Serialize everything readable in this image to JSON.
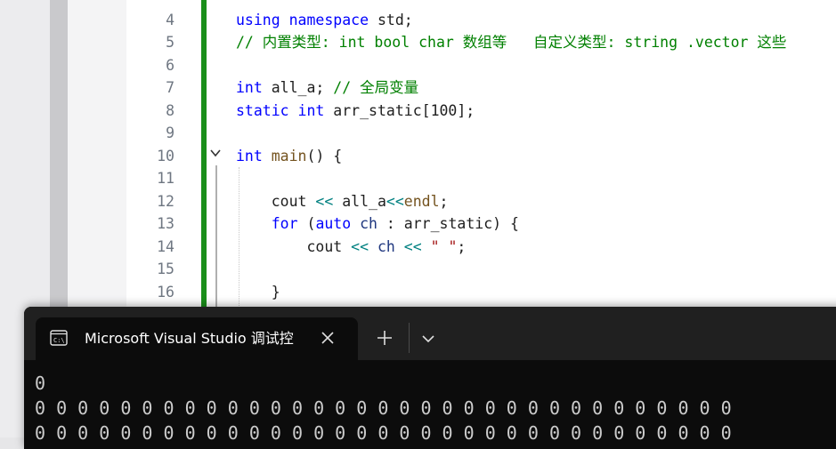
{
  "editor": {
    "lines": [
      {
        "num": "4",
        "segments": [
          {
            "t": "using ",
            "c": "kw"
          },
          {
            "t": "namespace ",
            "c": "kw"
          },
          {
            "t": "std;",
            "c": "pl"
          }
        ]
      },
      {
        "num": "5",
        "segments": [
          {
            "t": "// 内置类型: int bool char 数组等   自定义类型: string .vector 这些",
            "c": "cm"
          }
        ]
      },
      {
        "num": "6",
        "segments": []
      },
      {
        "num": "7",
        "segments": [
          {
            "t": "int ",
            "c": "kw"
          },
          {
            "t": "all_a; ",
            "c": "pl"
          },
          {
            "t": "// 全局变量",
            "c": "cm"
          }
        ]
      },
      {
        "num": "8",
        "segments": [
          {
            "t": "static ",
            "c": "kw"
          },
          {
            "t": "int ",
            "c": "kw"
          },
          {
            "t": "arr_static[100];",
            "c": "pl"
          }
        ]
      },
      {
        "num": "9",
        "segments": []
      },
      {
        "num": "10",
        "segments": [
          {
            "t": "int ",
            "c": "kw"
          },
          {
            "t": "main",
            "c": "fn"
          },
          {
            "t": "() {",
            "c": "pl"
          }
        ]
      },
      {
        "num": "11",
        "segments": []
      },
      {
        "num": "12",
        "segments": [
          {
            "t": "    cout ",
            "c": "pl"
          },
          {
            "t": "<<",
            "c": "op"
          },
          {
            "t": " all_a",
            "c": "pl"
          },
          {
            "t": "<<",
            "c": "op"
          },
          {
            "t": "endl",
            "c": "fn"
          },
          {
            "t": ";",
            "c": "pl"
          }
        ]
      },
      {
        "num": "13",
        "segments": [
          {
            "t": "    ",
            "c": "pl"
          },
          {
            "t": "for ",
            "c": "kw"
          },
          {
            "t": "(",
            "c": "pl"
          },
          {
            "t": "auto ",
            "c": "kw"
          },
          {
            "t": "ch",
            "c": "vr"
          },
          {
            "t": " : arr_static) {",
            "c": "pl"
          }
        ]
      },
      {
        "num": "14",
        "segments": [
          {
            "t": "        cout ",
            "c": "pl"
          },
          {
            "t": "<<",
            "c": "op"
          },
          {
            "t": " ",
            "c": "pl"
          },
          {
            "t": "ch",
            "c": "vr"
          },
          {
            "t": " ",
            "c": "pl"
          },
          {
            "t": "<<",
            "c": "op"
          },
          {
            "t": " ",
            "c": "pl"
          },
          {
            "t": "\" \"",
            "c": "st"
          },
          {
            "t": ";",
            "c": "pl"
          }
        ]
      },
      {
        "num": "15",
        "segments": []
      },
      {
        "num": "16",
        "segments": [
          {
            "t": "    }",
            "c": "pl"
          }
        ]
      }
    ]
  },
  "terminal": {
    "tab_title": "Microsoft Visual Studio 调试控",
    "output": [
      "0",
      "0 0 0 0 0 0 0 0 0 0 0 0 0 0 0 0 0 0 0 0 0 0 0 0 0 0 0 0 0 0 0 0 0",
      "0 0 0 0 0 0 0 0 0 0 0 0 0 0 0 0 0 0 0 0 0 0 0 0 0 0 0 0 0 0 0 0 0"
    ]
  }
}
